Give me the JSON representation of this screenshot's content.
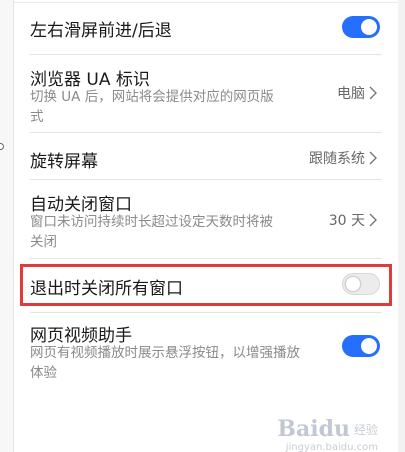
{
  "settings": [
    {
      "title": "左右滑屏前进/后退",
      "type": "toggle",
      "state": "on"
    },
    {
      "title": "浏览器 UA 标识",
      "subtitle": "切换 UA 后，网站将会提供对应的网页版式",
      "value": "电脑"
    },
    {
      "title": "旋转屏幕",
      "value": "跟随系统"
    },
    {
      "title": "自动关闭窗口",
      "subtitle": "窗口未访问持续时长超过设定天数时将被关闭",
      "value": "30 天"
    },
    {
      "title": "退出时关闭所有窗口",
      "type": "toggle",
      "state": "off"
    },
    {
      "title": "网页视频助手",
      "subtitle": "网页有视频播放时展示悬浮按钮，以增强播放体验",
      "type": "toggle",
      "state": "on"
    }
  ],
  "watermark": {
    "brand": "Baidu",
    "suffix": "经验",
    "url": "jingyan.baidu.com"
  },
  "colors": {
    "accent": "#256fff",
    "highlight": "#e03a3a"
  }
}
